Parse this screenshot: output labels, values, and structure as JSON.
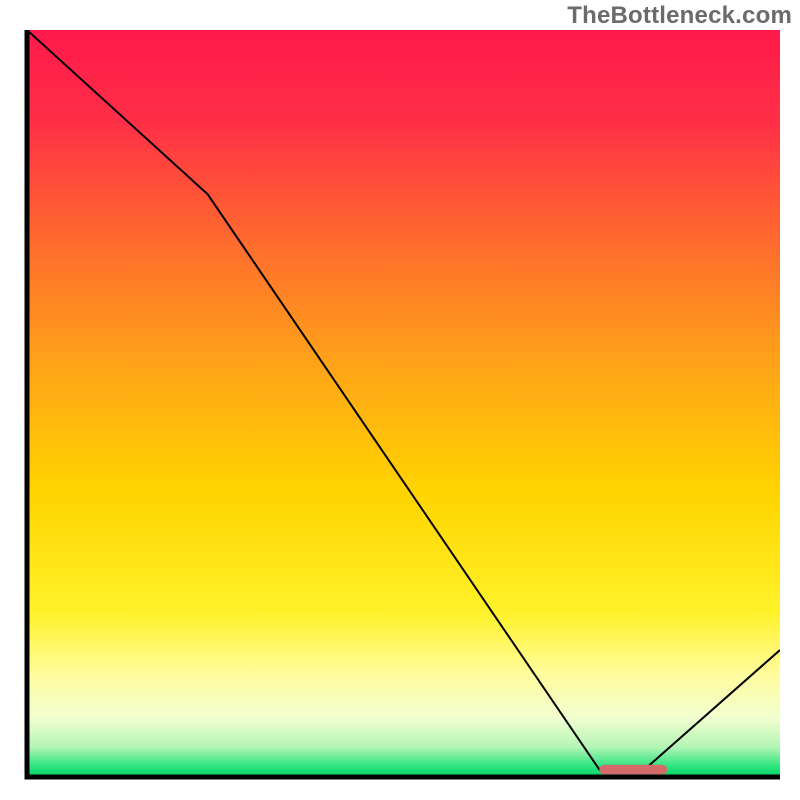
{
  "watermark": "TheBottleneck.com",
  "chart_data": {
    "type": "line",
    "title": "",
    "xlabel": "",
    "ylabel": "",
    "xlim": [
      0,
      100
    ],
    "ylim": [
      0,
      100
    ],
    "grid": false,
    "legend": false,
    "series": [
      {
        "name": "bottleneck-curve",
        "x": [
          0,
          24,
          76,
          82,
          100
        ],
        "y": [
          100,
          78,
          1,
          1,
          17
        ],
        "stroke": "#000000",
        "width": 2
      }
    ],
    "markers": [
      {
        "name": "optimal-band",
        "shape": "rounded-rect",
        "x_start": 76,
        "x_end": 85,
        "y": 1,
        "height": 1.3,
        "fill": "#d46a6a"
      }
    ],
    "background_gradient": {
      "stops": [
        {
          "pos": 0.0,
          "color": "#ff1a4b"
        },
        {
          "pos": 0.12,
          "color": "#ff2e47"
        },
        {
          "pos": 0.28,
          "color": "#ff6a2e"
        },
        {
          "pos": 0.45,
          "color": "#ffa418"
        },
        {
          "pos": 0.62,
          "color": "#ffd400"
        },
        {
          "pos": 0.78,
          "color": "#fff22a"
        },
        {
          "pos": 0.86,
          "color": "#fffc9a"
        },
        {
          "pos": 0.92,
          "color": "#f3ffd0"
        },
        {
          "pos": 0.96,
          "color": "#b3f5b6"
        },
        {
          "pos": 0.985,
          "color": "#2fe57f"
        },
        {
          "pos": 1.0,
          "color": "#07d268"
        }
      ]
    },
    "axes_color": "#000000",
    "axes_width": 5
  }
}
